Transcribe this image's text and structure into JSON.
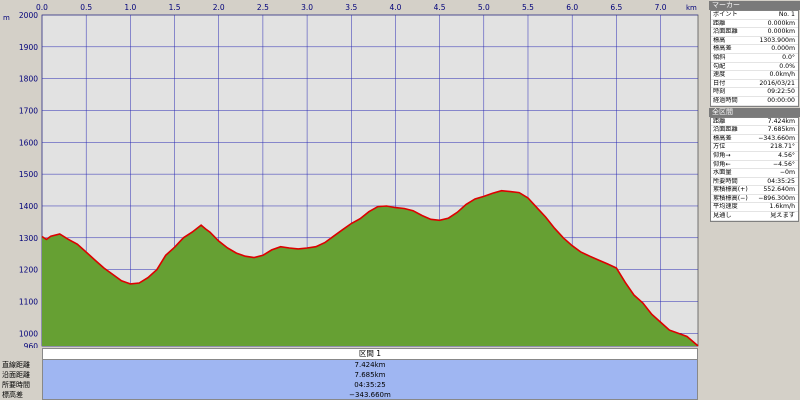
{
  "chart_data": {
    "type": "area",
    "xlabel": "km",
    "ylabel": "m",
    "xlim": [
      0.0,
      7.424
    ],
    "ylim": [
      960,
      2000
    ],
    "x_ticks": [
      0.0,
      0.5,
      1.0,
      1.5,
      2.0,
      2.5,
      3.0,
      3.5,
      4.0,
      4.5,
      5.0,
      5.5,
      6.0,
      6.5,
      7.0
    ],
    "x_tick_labels": [
      "0.0",
      "0.5",
      "1.0",
      "1.5",
      "2.0",
      "2.5",
      "3.0",
      "3.5",
      "4.0",
      "4.5",
      "5.0",
      "5.5",
      "6.0",
      "6.5",
      "7.0"
    ],
    "y_ticks": [
      960,
      1000,
      1100,
      1200,
      1300,
      1400,
      1500,
      1600,
      1700,
      1800,
      1900,
      2000
    ],
    "y_tick_labels": [
      "960",
      "1000",
      "1100",
      "1200",
      "1300",
      "1400",
      "1500",
      "1600",
      "1700",
      "1800",
      "1900",
      "2000"
    ],
    "grid": true,
    "colors": {
      "fill": "#66a033",
      "line": "#dd0000",
      "plot_bg": "#e2e2e2",
      "grid": "#2a2ab4"
    },
    "series": [
      {
        "x": [
          0.0,
          0.05,
          0.1,
          0.2,
          0.3,
          0.4,
          0.5,
          0.6,
          0.7,
          0.8,
          0.9,
          1.0,
          1.1,
          1.2,
          1.3,
          1.4,
          1.5,
          1.6,
          1.7,
          1.8,
          1.85,
          1.9,
          2.0,
          2.1,
          2.2,
          2.3,
          2.4,
          2.5,
          2.6,
          2.7,
          2.8,
          2.9,
          3.0,
          3.1,
          3.2,
          3.3,
          3.4,
          3.5,
          3.6,
          3.7,
          3.8,
          3.9,
          4.0,
          4.1,
          4.2,
          4.3,
          4.4,
          4.5,
          4.6,
          4.7,
          4.8,
          4.9,
          5.0,
          5.1,
          5.2,
          5.3,
          5.4,
          5.5,
          5.6,
          5.7,
          5.8,
          5.9,
          6.0,
          6.1,
          6.2,
          6.3,
          6.4,
          6.5,
          6.6,
          6.7,
          6.8,
          6.9,
          7.0,
          7.1,
          7.2,
          7.3,
          7.424
        ],
        "y": [
          1303.9,
          1295,
          1305,
          1312,
          1295,
          1280,
          1255,
          1230,
          1205,
          1185,
          1165,
          1155,
          1158,
          1175,
          1200,
          1245,
          1270,
          1300,
          1318,
          1340,
          1328,
          1318,
          1290,
          1268,
          1252,
          1242,
          1238,
          1245,
          1262,
          1272,
          1268,
          1265,
          1268,
          1272,
          1285,
          1305,
          1325,
          1345,
          1360,
          1382,
          1398,
          1400,
          1395,
          1392,
          1385,
          1370,
          1358,
          1355,
          1362,
          1380,
          1405,
          1422,
          1430,
          1440,
          1448,
          1445,
          1442,
          1425,
          1395,
          1365,
          1330,
          1300,
          1275,
          1255,
          1242,
          1230,
          1218,
          1205,
          1160,
          1120,
          1095,
          1060,
          1035,
          1010,
          1000,
          990,
          960.24
        ]
      }
    ]
  },
  "section": {
    "header": "区間 1",
    "rows": [
      {
        "label": "直線距離",
        "value": "7.424km"
      },
      {
        "label": "沿面距離",
        "value": "7.685km"
      },
      {
        "label": "所要時間",
        "value": "04:35:25"
      },
      {
        "label": "標高差",
        "value": "−343.660m"
      }
    ]
  },
  "marker": {
    "title": "マーカー",
    "rows": [
      {
        "k": "ポイント",
        "v": "No. 1"
      },
      {
        "k": "距離",
        "v": "0.000km"
      },
      {
        "k": "沿面距離",
        "v": "0.000km"
      },
      {
        "k": "標高",
        "v": "1303.900m"
      },
      {
        "k": "標高差",
        "v": "0.000m"
      },
      {
        "k": "傾斜",
        "v": "0.0°"
      },
      {
        "k": "勾配",
        "v": "0.0%"
      },
      {
        "k": "速度",
        "v": "0.0km/h"
      },
      {
        "k": "日付",
        "v": "2016/03/21"
      },
      {
        "k": "時刻",
        "v": "09:22:50"
      },
      {
        "k": "経過時間",
        "v": "00:00:00"
      }
    ]
  },
  "all_sections": {
    "title": "全区間",
    "rows": [
      {
        "k": "距離",
        "v": "7.424km"
      },
      {
        "k": "沿面距離",
        "v": "7.685km"
      },
      {
        "k": "標高差",
        "v": "−343.660m"
      },
      {
        "k": "方位",
        "v": "218.71°"
      },
      {
        "k": "仰角→",
        "v": "4.56°"
      },
      {
        "k": "仰角←",
        "v": "−4.56°"
      },
      {
        "k": "水面量",
        "v": "−0m"
      },
      {
        "k": "所要時間",
        "v": "04:35:25"
      },
      {
        "k": "累積標高(+)",
        "v": "552.640m"
      },
      {
        "k": "累積標高(−)",
        "v": "−896.300m"
      },
      {
        "k": "平均速度",
        "v": "1.6km/h"
      },
      {
        "k": "見通し",
        "v": "見えます"
      }
    ]
  }
}
